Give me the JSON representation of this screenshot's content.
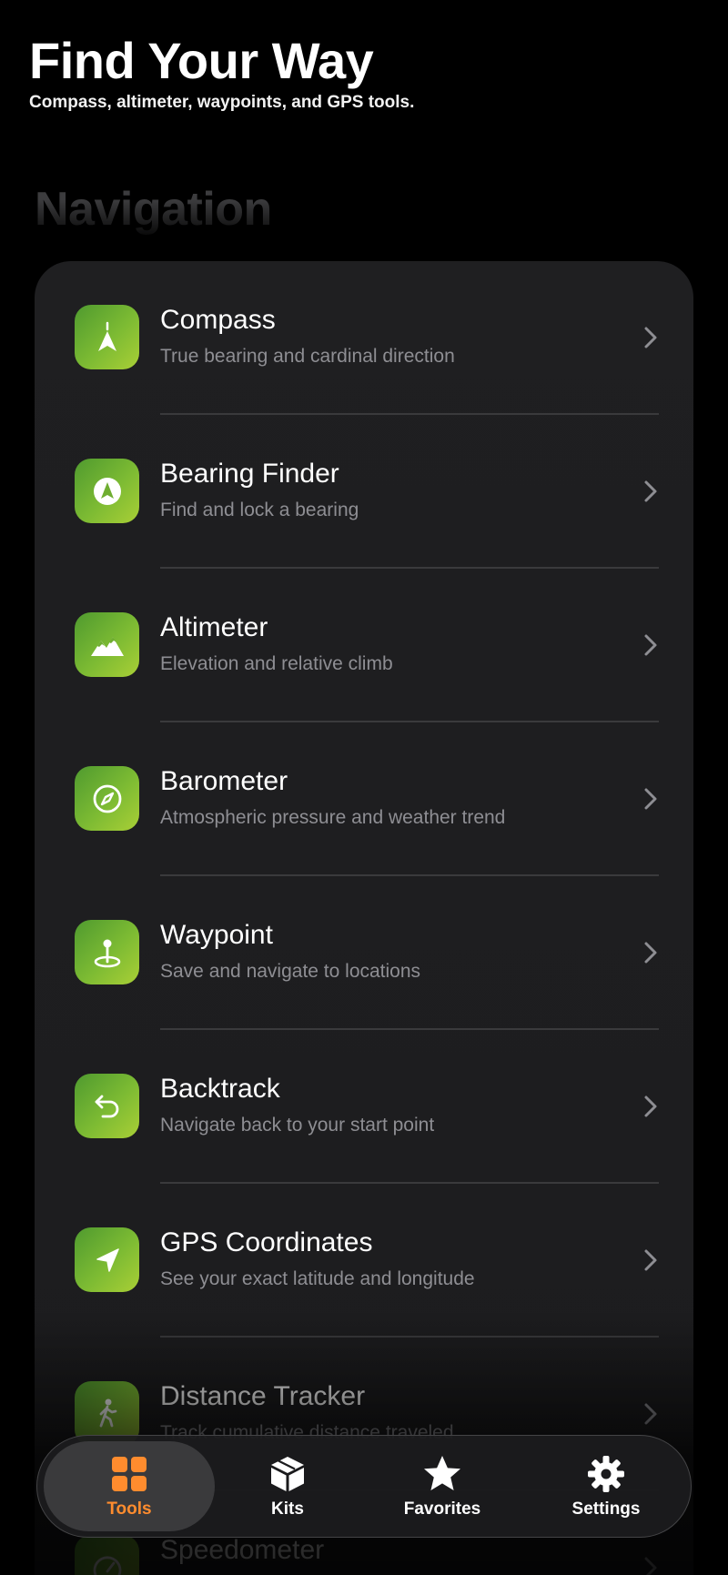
{
  "header": {
    "title": "Find Your Way",
    "subtitle": "Compass, altimeter, waypoints, and GPS tools."
  },
  "section": {
    "heading": "Navigation"
  },
  "tools": [
    {
      "name": "Compass",
      "description": "True bearing and cardinal direction",
      "icon": "compass-needle-icon"
    },
    {
      "name": "Bearing Finder",
      "description": "Find and lock a bearing",
      "icon": "bearing-arrow-icon"
    },
    {
      "name": "Altimeter",
      "description": "Elevation and relative climb",
      "icon": "mountains-icon"
    },
    {
      "name": "Barometer",
      "description": "Atmospheric pressure and weather trend",
      "icon": "gauge-icon"
    },
    {
      "name": "Waypoint",
      "description": "Save and navigate to locations",
      "icon": "map-pin-icon"
    },
    {
      "name": "Backtrack",
      "description": "Navigate back to your start point",
      "icon": "return-arrow-icon"
    },
    {
      "name": "GPS Coordinates",
      "description": "See your exact latitude and longitude",
      "icon": "location-arrow-icon"
    },
    {
      "name": "Distance Tracker",
      "description": "Track cumulative distance traveled",
      "icon": "walking-person-icon"
    },
    {
      "name": "Speedometer",
      "description": "",
      "icon": "speedometer-icon"
    }
  ],
  "tabbar": {
    "active": "Tools",
    "tabs": [
      {
        "label": "Tools",
        "icon": "grid-icon"
      },
      {
        "label": "Kits",
        "icon": "box-icon"
      },
      {
        "label": "Favorites",
        "icon": "star-icon"
      },
      {
        "label": "Settings",
        "icon": "gear-icon"
      }
    ]
  },
  "colors": {
    "accent": "#ff8c2e",
    "icon_gradient_start": "#4f9a2f",
    "icon_gradient_end": "#a9cf36",
    "card_background": "#1c1c1e",
    "secondary_text": "#8e8e93"
  }
}
